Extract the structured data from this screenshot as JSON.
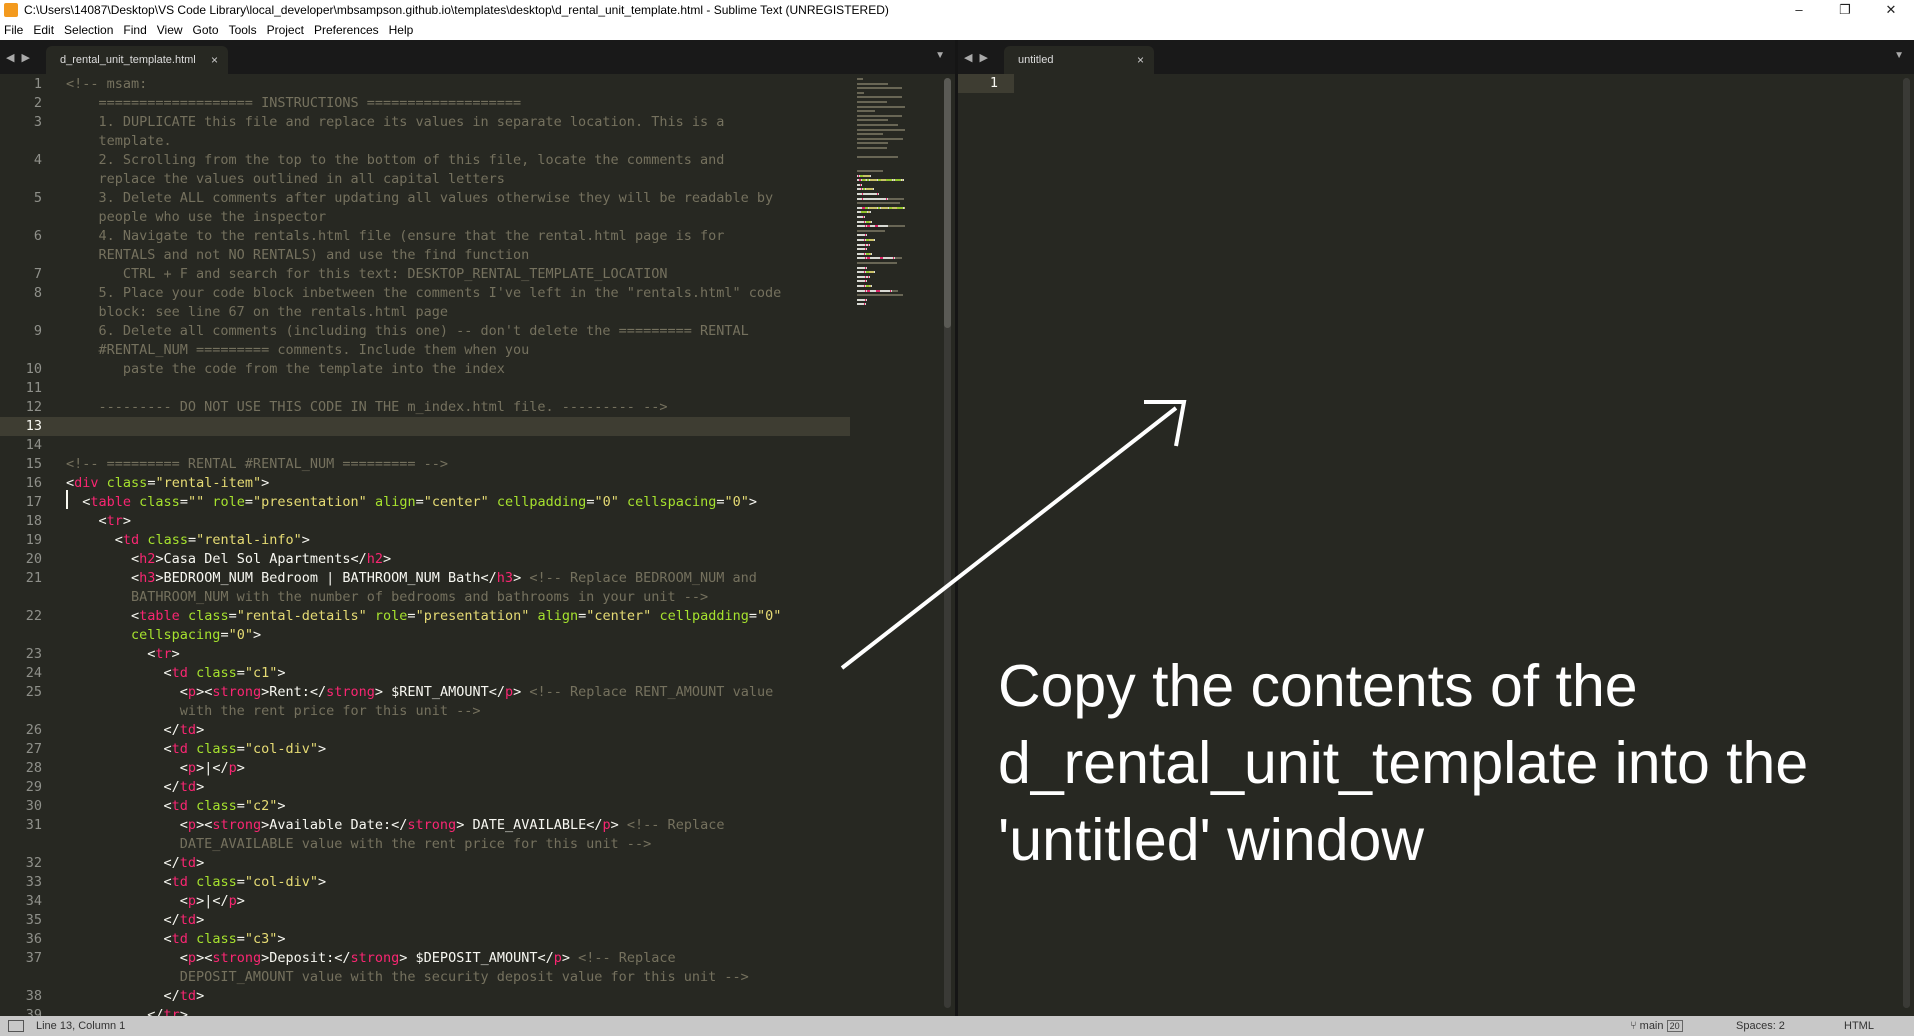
{
  "window": {
    "title": "C:\\Users\\14087\\Desktop\\VS Code Library\\local_developer\\mbsampson.github.io\\templates\\desktop\\d_rental_unit_template.html - Sublime Text (UNREGISTERED)",
    "minimize": "–",
    "maximize": "❐",
    "close": "✕"
  },
  "menu": [
    "File",
    "Edit",
    "Selection",
    "Find",
    "View",
    "Goto",
    "Tools",
    "Project",
    "Preferences",
    "Help"
  ],
  "left_pane": {
    "nav_arrows": "◀ ▶",
    "tab_label": "d_rental_unit_template.html",
    "tab_close": "×",
    "dropdown": "▼"
  },
  "right_pane": {
    "nav_arrows": "◀ ▶",
    "tab_label": "untitled",
    "tab_close": "×",
    "dropdown": "▼",
    "line_number": "1"
  },
  "line_numbers": [
    "1",
    "2",
    "3",
    "",
    "4",
    "",
    "5",
    "",
    "6",
    "",
    "7",
    "8",
    "",
    "9",
    "",
    "10",
    "11",
    "12",
    "13",
    "14",
    "15",
    "16",
    "17",
    "18",
    "19",
    "20",
    "21",
    "",
    "22",
    "",
    "23",
    "24",
    "25",
    "",
    "26",
    "27",
    "28",
    "29",
    "30",
    "31",
    "",
    "32",
    "33",
    "34",
    "35",
    "36",
    "37",
    "",
    "38",
    "39"
  ],
  "code_lines": [
    [
      [
        "cm",
        "<!-- msam:"
      ]
    ],
    [
      [
        "cm",
        "    =================== INSTRUCTIONS ==================="
      ]
    ],
    [
      [
        "cm",
        "    1. DUPLICATE this file and replace its values in separate location. This is a"
      ]
    ],
    [
      [
        "cm",
        "    template."
      ]
    ],
    [
      [
        "cm",
        "    2. Scrolling from the top to the bottom of this file, locate the comments and"
      ]
    ],
    [
      [
        "cm",
        "    replace the values outlined in all capital letters"
      ]
    ],
    [
      [
        "cm",
        "    3. Delete ALL comments after updating all values otherwise they will be readable by"
      ]
    ],
    [
      [
        "cm",
        "    people who use the inspector"
      ]
    ],
    [
      [
        "cm",
        "    4. Navigate to the rentals.html file (ensure that the rental.html page is for"
      ]
    ],
    [
      [
        "cm",
        "    RENTALS and not NO RENTALS) and use the find function"
      ]
    ],
    [
      [
        "cm",
        "       CTRL + F and search for this text: DESKTOP_RENTAL_TEMPLATE_LOCATION"
      ]
    ],
    [
      [
        "cm",
        "    5. Place your code block inbetween the comments I've left in the \"rentals.html\" code"
      ]
    ],
    [
      [
        "cm",
        "    block: see line 67 on the rentals.html page"
      ]
    ],
    [
      [
        "cm",
        "    6. Delete all comments (including this one) -- don't delete the ========= RENTAL"
      ]
    ],
    [
      [
        "cm",
        "    #RENTAL_NUM ========= comments. Include them when you"
      ]
    ],
    [
      [
        "cm",
        "       paste the code from the template into the index"
      ]
    ],
    [
      [
        "tx",
        ""
      ]
    ],
    [
      [
        "cm",
        "    --------- DO NOT USE THIS CODE IN THE m_index.html file. --------- -->"
      ]
    ],
    [
      [
        "tx",
        ""
      ]
    ],
    [
      [
        "tx",
        ""
      ]
    ],
    [
      [
        "cm",
        "<!-- ========= RENTAL #RENTAL_NUM ========= -->"
      ]
    ],
    [
      [
        "tx",
        "<"
      ],
      [
        "tg",
        "div"
      ],
      [
        "tx",
        " "
      ],
      [
        "at",
        "class"
      ],
      [
        "tx",
        "="
      ],
      [
        "st",
        "\"rental-item\""
      ],
      [
        "tx",
        ">"
      ]
    ],
    [
      [
        "tx",
        "  <"
      ],
      [
        "tg",
        "table"
      ],
      [
        "tx",
        " "
      ],
      [
        "at",
        "class"
      ],
      [
        "tx",
        "="
      ],
      [
        "st",
        "\"\""
      ],
      [
        "tx",
        " "
      ],
      [
        "at",
        "role"
      ],
      [
        "tx",
        "="
      ],
      [
        "st",
        "\"presentation\""
      ],
      [
        "tx",
        " "
      ],
      [
        "at",
        "align"
      ],
      [
        "tx",
        "="
      ],
      [
        "st",
        "\"center\""
      ],
      [
        "tx",
        " "
      ],
      [
        "at",
        "cellpadding"
      ],
      [
        "tx",
        "="
      ],
      [
        "st",
        "\"0\""
      ],
      [
        "tx",
        " "
      ],
      [
        "at",
        "cellspacing"
      ],
      [
        "tx",
        "="
      ],
      [
        "st",
        "\"0\""
      ],
      [
        "tx",
        ">"
      ]
    ],
    [
      [
        "tx",
        "    <"
      ],
      [
        "tg",
        "tr"
      ],
      [
        "tx",
        ">"
      ]
    ],
    [
      [
        "tx",
        "      <"
      ],
      [
        "tg",
        "td"
      ],
      [
        "tx",
        " "
      ],
      [
        "at",
        "class"
      ],
      [
        "tx",
        "="
      ],
      [
        "st",
        "\"rental-info\""
      ],
      [
        "tx",
        ">"
      ]
    ],
    [
      [
        "tx",
        "        <"
      ],
      [
        "tg",
        "h2"
      ],
      [
        "tx",
        ">Casa Del Sol Apartments</"
      ],
      [
        "tg",
        "h2"
      ],
      [
        "tx",
        ">"
      ]
    ],
    [
      [
        "tx",
        "        <"
      ],
      [
        "tg",
        "h3"
      ],
      [
        "tx",
        ">BEDROOM_NUM Bedroom | BATHROOM_NUM Bath</"
      ],
      [
        "tg",
        "h3"
      ],
      [
        "tx",
        "> "
      ],
      [
        "cm",
        "<!-- Replace BEDROOM_NUM and"
      ]
    ],
    [
      [
        "cm",
        "        BATHROOM_NUM with the number of bedrooms and bathrooms in your unit -->"
      ]
    ],
    [
      [
        "tx",
        "        <"
      ],
      [
        "tg",
        "table"
      ],
      [
        "tx",
        " "
      ],
      [
        "at",
        "class"
      ],
      [
        "tx",
        "="
      ],
      [
        "st",
        "\"rental-details\""
      ],
      [
        "tx",
        " "
      ],
      [
        "at",
        "role"
      ],
      [
        "tx",
        "="
      ],
      [
        "st",
        "\"presentation\""
      ],
      [
        "tx",
        " "
      ],
      [
        "at",
        "align"
      ],
      [
        "tx",
        "="
      ],
      [
        "st",
        "\"center\""
      ],
      [
        "tx",
        " "
      ],
      [
        "at",
        "cellpadding"
      ],
      [
        "tx",
        "="
      ],
      [
        "st",
        "\"0\""
      ]
    ],
    [
      [
        "tx",
        "        "
      ],
      [
        "at",
        "cellspacing"
      ],
      [
        "tx",
        "="
      ],
      [
        "st",
        "\"0\""
      ],
      [
        "tx",
        ">"
      ]
    ],
    [
      [
        "tx",
        "          <"
      ],
      [
        "tg",
        "tr"
      ],
      [
        "tx",
        ">"
      ]
    ],
    [
      [
        "tx",
        "            <"
      ],
      [
        "tg",
        "td"
      ],
      [
        "tx",
        " "
      ],
      [
        "at",
        "class"
      ],
      [
        "tx",
        "="
      ],
      [
        "st",
        "\"c1\""
      ],
      [
        "tx",
        ">"
      ]
    ],
    [
      [
        "tx",
        "              <"
      ],
      [
        "tg",
        "p"
      ],
      [
        "tx",
        "><"
      ],
      [
        "tg",
        "strong"
      ],
      [
        "tx",
        ">Rent:</"
      ],
      [
        "tg",
        "strong"
      ],
      [
        "tx",
        "> $RENT_AMOUNT</"
      ],
      [
        "tg",
        "p"
      ],
      [
        "tx",
        "> "
      ],
      [
        "cm",
        "<!-- Replace RENT_AMOUNT value"
      ]
    ],
    [
      [
        "cm",
        "              with the rent price for this unit -->"
      ]
    ],
    [
      [
        "tx",
        "            </"
      ],
      [
        "tg",
        "td"
      ],
      [
        "tx",
        ">"
      ]
    ],
    [
      [
        "tx",
        "            <"
      ],
      [
        "tg",
        "td"
      ],
      [
        "tx",
        " "
      ],
      [
        "at",
        "class"
      ],
      [
        "tx",
        "="
      ],
      [
        "st",
        "\"col-div\""
      ],
      [
        "tx",
        ">"
      ]
    ],
    [
      [
        "tx",
        "              <"
      ],
      [
        "tg",
        "p"
      ],
      [
        "tx",
        ">|</"
      ],
      [
        "tg",
        "p"
      ],
      [
        "tx",
        ">"
      ]
    ],
    [
      [
        "tx",
        "            </"
      ],
      [
        "tg",
        "td"
      ],
      [
        "tx",
        ">"
      ]
    ],
    [
      [
        "tx",
        "            <"
      ],
      [
        "tg",
        "td"
      ],
      [
        "tx",
        " "
      ],
      [
        "at",
        "class"
      ],
      [
        "tx",
        "="
      ],
      [
        "st",
        "\"c2\""
      ],
      [
        "tx",
        ">"
      ]
    ],
    [
      [
        "tx",
        "              <"
      ],
      [
        "tg",
        "p"
      ],
      [
        "tx",
        "><"
      ],
      [
        "tg",
        "strong"
      ],
      [
        "tx",
        ">Available Date:</"
      ],
      [
        "tg",
        "strong"
      ],
      [
        "tx",
        "> DATE_AVAILABLE</"
      ],
      [
        "tg",
        "p"
      ],
      [
        "tx",
        "> "
      ],
      [
        "cm",
        "<!-- Replace"
      ]
    ],
    [
      [
        "cm",
        "              DATE_AVAILABLE value with the rent price for this unit -->"
      ]
    ],
    [
      [
        "tx",
        "            </"
      ],
      [
        "tg",
        "td"
      ],
      [
        "tx",
        ">"
      ]
    ],
    [
      [
        "tx",
        "            <"
      ],
      [
        "tg",
        "td"
      ],
      [
        "tx",
        " "
      ],
      [
        "at",
        "class"
      ],
      [
        "tx",
        "="
      ],
      [
        "st",
        "\"col-div\""
      ],
      [
        "tx",
        ">"
      ]
    ],
    [
      [
        "tx",
        "              <"
      ],
      [
        "tg",
        "p"
      ],
      [
        "tx",
        ">|</"
      ],
      [
        "tg",
        "p"
      ],
      [
        "tx",
        ">"
      ]
    ],
    [
      [
        "tx",
        "            </"
      ],
      [
        "tg",
        "td"
      ],
      [
        "tx",
        ">"
      ]
    ],
    [
      [
        "tx",
        "            <"
      ],
      [
        "tg",
        "td"
      ],
      [
        "tx",
        " "
      ],
      [
        "at",
        "class"
      ],
      [
        "tx",
        "="
      ],
      [
        "st",
        "\"c3\""
      ],
      [
        "tx",
        ">"
      ]
    ],
    [
      [
        "tx",
        "              <"
      ],
      [
        "tg",
        "p"
      ],
      [
        "tx",
        "><"
      ],
      [
        "tg",
        "strong"
      ],
      [
        "tx",
        ">Deposit:</"
      ],
      [
        "tg",
        "strong"
      ],
      [
        "tx",
        "> $DEPOSIT_AMOUNT</"
      ],
      [
        "tg",
        "p"
      ],
      [
        "tx",
        "> "
      ],
      [
        "cm",
        "<!-- Replace"
      ]
    ],
    [
      [
        "cm",
        "              DEPOSIT_AMOUNT value with the security deposit value for this unit -->"
      ]
    ],
    [
      [
        "tx",
        "            </"
      ],
      [
        "tg",
        "td"
      ],
      [
        "tx",
        ">"
      ]
    ],
    [
      [
        "tx",
        "          </"
      ],
      [
        "tg",
        "tr"
      ],
      [
        "tx",
        ">"
      ]
    ]
  ],
  "current_line_index": 18,
  "annotation": "Copy the contents of the d_rental_unit_template into the 'untitled' window",
  "status": {
    "position": "Line 13, Column 1",
    "branch": "main",
    "branch_badge": "20",
    "spaces": "Spaces: 2",
    "syntax": "HTML"
  },
  "colors": {
    "background": "#272822",
    "comment": "#75715e",
    "tag": "#f92672",
    "attribute": "#a6e22e",
    "string": "#e6db74",
    "text": "#f8f8f2"
  }
}
